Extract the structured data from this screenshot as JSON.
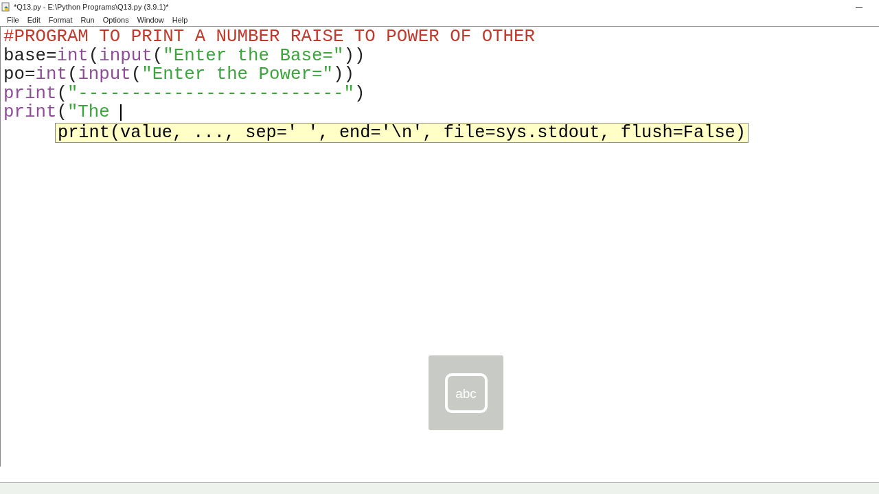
{
  "window": {
    "title": "*Q13.py - E:\\Python Programs\\Q13.py (3.9.1)*"
  },
  "menu": [
    "File",
    "Edit",
    "Format",
    "Run",
    "Options",
    "Window",
    "Help"
  ],
  "editor": {
    "lines": [
      [
        {
          "kind": "comment",
          "text": "#PROGRAM TO PRINT A NUMBER RAISE TO POWER OF OTHER"
        }
      ],
      [
        {
          "kind": "plain",
          "text": "base="
        },
        {
          "kind": "builtin",
          "text": "int"
        },
        {
          "kind": "plain",
          "text": "("
        },
        {
          "kind": "builtin",
          "text": "input"
        },
        {
          "kind": "plain",
          "text": "("
        },
        {
          "kind": "string",
          "text": "\"Enter the Base=\""
        },
        {
          "kind": "plain",
          "text": "))"
        }
      ],
      [
        {
          "kind": "plain",
          "text": "po="
        },
        {
          "kind": "builtin",
          "text": "int"
        },
        {
          "kind": "plain",
          "text": "("
        },
        {
          "kind": "builtin",
          "text": "input"
        },
        {
          "kind": "plain",
          "text": "("
        },
        {
          "kind": "string",
          "text": "\"Enter the Power=\""
        },
        {
          "kind": "plain",
          "text": "))"
        }
      ],
      [
        {
          "kind": "builtin",
          "text": "print"
        },
        {
          "kind": "plain",
          "text": "("
        },
        {
          "kind": "string",
          "text": "\"-------------------------\""
        },
        {
          "kind": "plain",
          "text": ")"
        }
      ],
      [
        {
          "kind": "builtin",
          "text": "print"
        },
        {
          "kind": "plain",
          "text": "("
        },
        {
          "kind": "string",
          "text": "\"The "
        }
      ]
    ],
    "calltip": "print(value, ..., sep=' ', end='\\n', file=sys.stdout, flush=False)"
  },
  "keyboard_overlay": {
    "label": "abc"
  }
}
